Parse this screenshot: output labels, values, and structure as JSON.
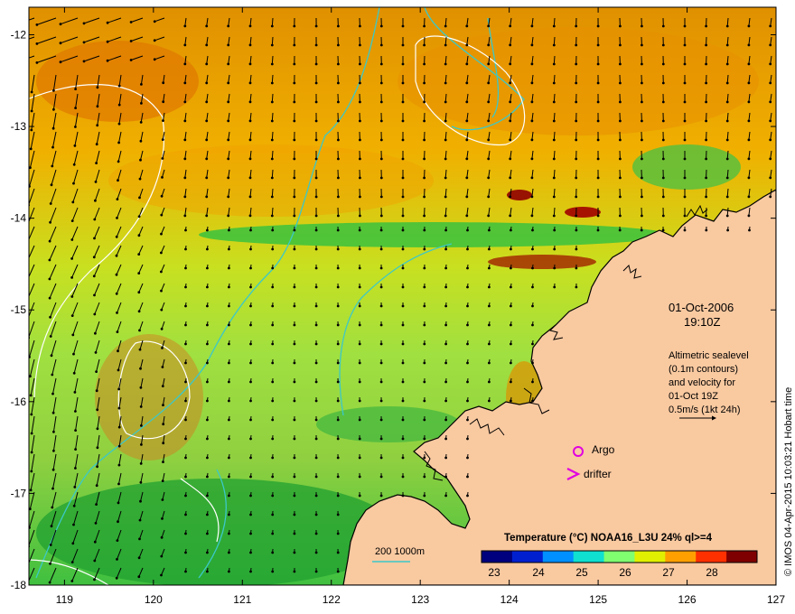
{
  "map": {
    "lon_ticks": [
      "119",
      "120",
      "121",
      "122",
      "123",
      "124",
      "125",
      "126",
      "127"
    ],
    "lat_ticks": [
      "-12",
      "-13",
      "-14",
      "-15",
      "-16",
      "-17",
      "-18"
    ],
    "lon_range": [
      118.6,
      127.0
    ],
    "lat_range": [
      -18.0,
      -11.7
    ]
  },
  "annotations": {
    "date": "01-Oct-2006",
    "time": "19:10Z",
    "altimetry_lines": [
      "Altimetric sealevel",
      "(0.1m contours)",
      "and velocity for",
      "01-Oct 19Z",
      "0.5m/s (1kt 24h)"
    ],
    "argo_label": "Argo",
    "drifter_label": "drifter",
    "isobath_label": "200  1000m",
    "credit": "© IMOS 04-Apr-2015 10:03:21 Hobart time"
  },
  "colorbar": {
    "title": "Temperature (°C) NOAA16_L3U 24% ql>=4",
    "ticks": [
      "23",
      "24",
      "25",
      "26",
      "27",
      "28"
    ],
    "colors": [
      "#00007f",
      "#0020d0",
      "#0090ff",
      "#10e0d0",
      "#80ff70",
      "#e0f000",
      "#ffa000",
      "#ff3000",
      "#7f0000"
    ]
  },
  "colors": {
    "land": "#f9c9a0",
    "coast": "#000000",
    "isobath": "#3cc8c8",
    "contour": "#ffffff",
    "marker": "#e000e0"
  }
}
